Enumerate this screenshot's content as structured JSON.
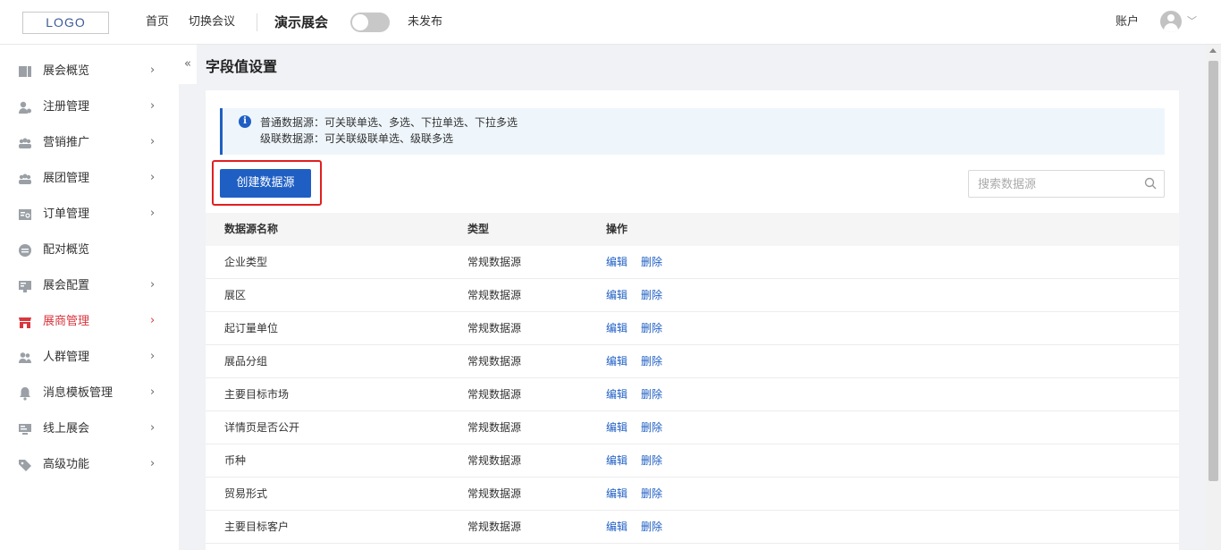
{
  "header": {
    "logo": "LOGO",
    "nav": [
      "首页",
      "切换会议"
    ],
    "event_name": "演示展会",
    "publish_toggle_on": false,
    "status": "未发布",
    "account": "账户"
  },
  "sidebar": {
    "collapse_icon": "«",
    "items": [
      {
        "label": "展会概览",
        "icon": "dashboard-icon",
        "arrow": "›"
      },
      {
        "label": "注册管理",
        "icon": "user-register-icon",
        "arrow": "›"
      },
      {
        "label": "营销推广",
        "icon": "group-icon",
        "arrow": "›"
      },
      {
        "label": "展团管理",
        "icon": "group-icon",
        "arrow": "›"
      },
      {
        "label": "订单管理",
        "icon": "order-icon",
        "arrow": "›"
      },
      {
        "label": "配对概览",
        "icon": "match-icon",
        "arrow": ""
      },
      {
        "label": "展会配置",
        "icon": "config-icon",
        "arrow": "›"
      },
      {
        "label": "展商管理",
        "icon": "store-icon",
        "arrow": "›",
        "active": true
      },
      {
        "label": "人群管理",
        "icon": "people-icon",
        "arrow": "›"
      },
      {
        "label": "消息模板管理",
        "icon": "bell-icon",
        "arrow": "›"
      },
      {
        "label": "线上展会",
        "icon": "monitor-icon",
        "arrow": "›"
      },
      {
        "label": "高级功能",
        "icon": "tag-icon",
        "arrow": "›"
      }
    ]
  },
  "main": {
    "title": "字段值设置",
    "info": {
      "line1": "普通数据源：可关联单选、多选、下拉单选、下拉多选",
      "line2": "级联数据源：可关联级联单选、级联多选"
    },
    "create_button": "创建数据源",
    "search_placeholder": "搜索数据源",
    "table": {
      "columns": [
        "数据源名称",
        "类型",
        "操作"
      ],
      "rows": [
        {
          "name": "企业类型",
          "type": "常规数据源"
        },
        {
          "name": "展区",
          "type": "常规数据源"
        },
        {
          "name": "起订量单位",
          "type": "常规数据源"
        },
        {
          "name": "展品分组",
          "type": "常规数据源"
        },
        {
          "name": "主要目标市场",
          "type": "常规数据源"
        },
        {
          "name": "详情页是否公开",
          "type": "常规数据源"
        },
        {
          "name": "币种",
          "type": "常规数据源"
        },
        {
          "name": "贸易形式",
          "type": "常规数据源"
        },
        {
          "name": "主要目标客户",
          "type": "常规数据源"
        }
      ],
      "edit_label": "编辑",
      "delete_label": "删除"
    }
  },
  "colors": {
    "primary": "#1f5fc4",
    "active_nav": "#d9363e",
    "highlight_border": "#e02020",
    "info_bg": "#eef6fc"
  }
}
